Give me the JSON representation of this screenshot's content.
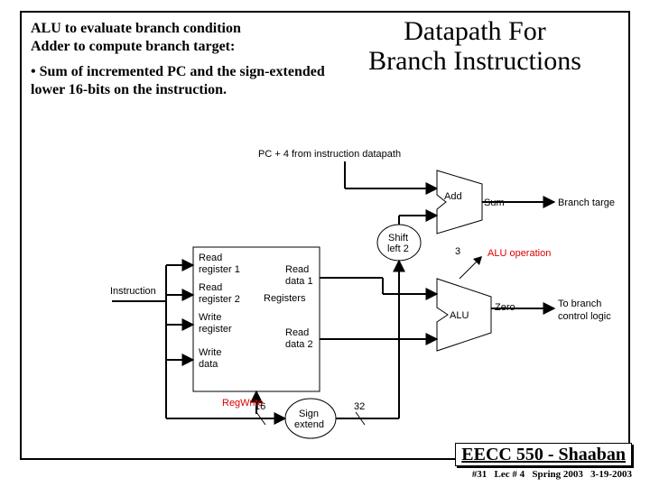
{
  "title_line1": "Datapath For",
  "title_line2": "Branch Instructions",
  "desc": {
    "line1": "ALU to evaluate branch condition",
    "line2": "Adder to compute branch target:",
    "bullet": "• Sum of incremented PC and the sign-extended lower 16-bits on the instruction."
  },
  "labels": {
    "pc4": "PC + 4 from instruction datapath",
    "instruction": "Instruction",
    "add": "Add",
    "sum": "Sum",
    "branch_target": "Branch targe",
    "shift": "Shift",
    "left2": "left 2",
    "alu_op": "ALU operation",
    "alu_op_bits": "3",
    "alu": "ALU",
    "zero": "Zero",
    "to_branch": "To branch",
    "control_logic": "control logic",
    "read_reg1": "Read",
    "register1": "register 1",
    "read_reg2": "Read",
    "register2": "register 2",
    "write_reg": "Write",
    "registerw": "register",
    "write_data": "Write",
    "dataw": "data",
    "registers": "Registers",
    "read_data1": "Read",
    "data1": "data 1",
    "read_data2": "Read",
    "data2": "data 2",
    "regwrite": "RegWrite",
    "sign": "Sign",
    "extend": "extend",
    "bits16": "16",
    "bits32": "32"
  },
  "footer": {
    "course": "EECC 550 - Shaaban",
    "slide": "#31",
    "lec": "Lec # 4",
    "term": "Spring 2003",
    "date": "3-19-2003"
  }
}
